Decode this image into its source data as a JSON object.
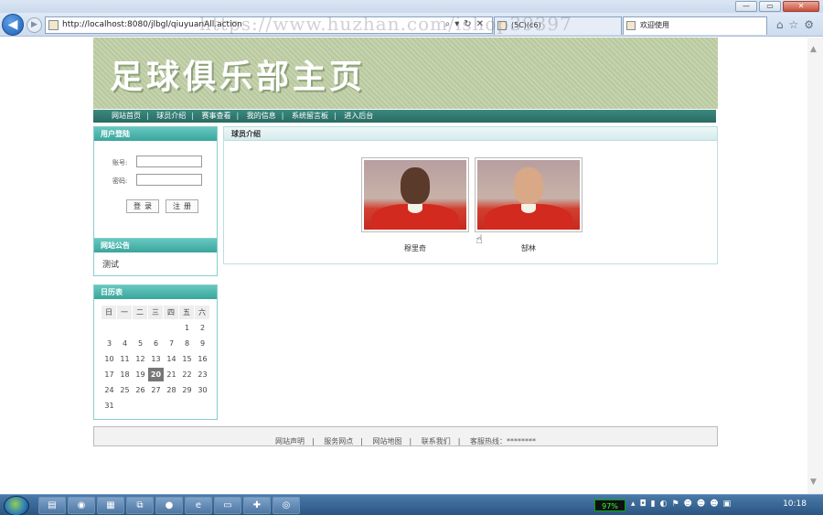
{
  "browser": {
    "address": "http://localhost:8080/jlbgl/qiuyuanAll.action",
    "tab1": "(5C)(c6)",
    "tab2": "欢迎使用",
    "watermark": "https://www.huzhan.com/ishop39397",
    "back_icon": "back-arrow-icon",
    "forward_icon": "forward-arrow-icon"
  },
  "page": {
    "banner_title": "足球俱乐部主页",
    "menu": [
      "网站首页",
      "球员介绍",
      "赛事查看",
      "我的信息",
      "系统留言板",
      "进入后台"
    ],
    "login": {
      "title": "用户登陆",
      "username_label": "账号:",
      "username_value": "",
      "password_label": "密码:",
      "password_value": "",
      "login_button": "登录",
      "register_button": "注册"
    },
    "notice": {
      "title": "网站公告",
      "text": "测试"
    },
    "calendar": {
      "title": "日历表",
      "weekdays": [
        "日",
        "一",
        "二",
        "三",
        "四",
        "五",
        "六"
      ],
      "rows": [
        [
          "",
          "",
          "",
          "",
          "",
          "1",
          "2"
        ],
        [
          "3",
          "4",
          "5",
          "6",
          "7",
          "8",
          "9"
        ],
        [
          "10",
          "11",
          "12",
          "13",
          "14",
          "15",
          "16"
        ],
        [
          "17",
          "18",
          "19",
          "20",
          "21",
          "22",
          "23"
        ],
        [
          "24",
          "25",
          "26",
          "27",
          "28",
          "29",
          "30"
        ],
        [
          "31",
          "",
          "",
          "",
          "",
          "",
          ""
        ]
      ],
      "today": "20"
    },
    "main": {
      "title": "球员介绍",
      "players": [
        {
          "name": "穆里奇",
          "skin": "#5a3a2a"
        },
        {
          "name": "郜林",
          "skin": "#d8a887"
        }
      ]
    },
    "footer": {
      "links": [
        "网站声明",
        "服务网点",
        "网站地图",
        "联系我们",
        "客服热线：********"
      ],
      "separator": "|"
    }
  },
  "taskbar": {
    "battery": "97%",
    "clock": "10:18",
    "apps": [
      "folder-icon",
      "media-icon",
      "archive-icon",
      "network-icon",
      "firefox-icon",
      "ie-icon",
      "terminal-icon",
      "puzzle-icon",
      "chrome-icon"
    ]
  },
  "colors": {
    "teal_header": "#3aa59c",
    "menu_bar": "#2a6a62",
    "banner": "#bfcea5"
  }
}
